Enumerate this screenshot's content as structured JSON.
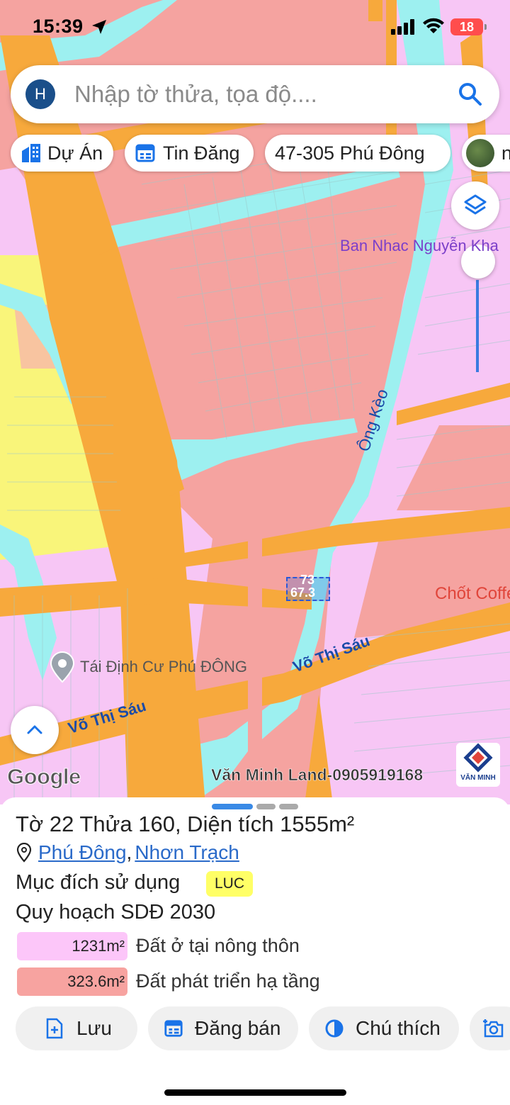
{
  "status": {
    "time": "15:39",
    "battery": "18"
  },
  "search": {
    "avatar_letter": "H",
    "placeholder": "Nhập tờ thửa, tọa độ...."
  },
  "chips": {
    "du_an": "Dự Án",
    "tin_dang": "Tin Đăng",
    "location": "47-305 Phú Đông",
    "partial": "n"
  },
  "map": {
    "labels": {
      "ban_nhac": "Ban Nhac Nguyễn Kha",
      "ong_keo": "Ông Kèo",
      "chot_coffee": "Chốt Coffee",
      "tai_dinh_cu": "Tái Định Cư Phú ĐÔNG",
      "vo_thi_sau": "Võ Thị Sáu"
    },
    "parcel_numbers": [
      "73",
      "67.3"
    ],
    "google": "Google",
    "watermark": "Văn Minh Land-0905919168",
    "logo_text": "VĂN MINH",
    "colors": {
      "residential": "#f7c6f5",
      "infrastructure": "#f5a3a0",
      "road": "#f7a93c",
      "water": "#9df0f0",
      "agriculture": "#f9f57a"
    }
  },
  "sheet": {
    "title_prefix": "Tờ ",
    "sheet_no": "22",
    "parcel_label": " Thửa ",
    "parcel_no": "160",
    "area_label": ", Diện tích ",
    "area_value": "1555m²",
    "commune": "Phú Đông",
    "separator": ",",
    "district": "Nhơn Trạch",
    "purpose_label": "Mục đích sử dụng",
    "purpose_code": "LUC",
    "plan_title": "Quy hoạch SDĐ 2030",
    "zones": [
      {
        "area": "1231m²",
        "label": "Đất ở tại nông thôn",
        "color": "#fcc6f9"
      },
      {
        "area": "323.6m²",
        "label": "Đất phát triển hạ tầng",
        "color": "#f7a3a0"
      }
    ]
  },
  "actions": {
    "save": "Lưu",
    "post": "Đăng bán",
    "legend": "Chú thích"
  }
}
